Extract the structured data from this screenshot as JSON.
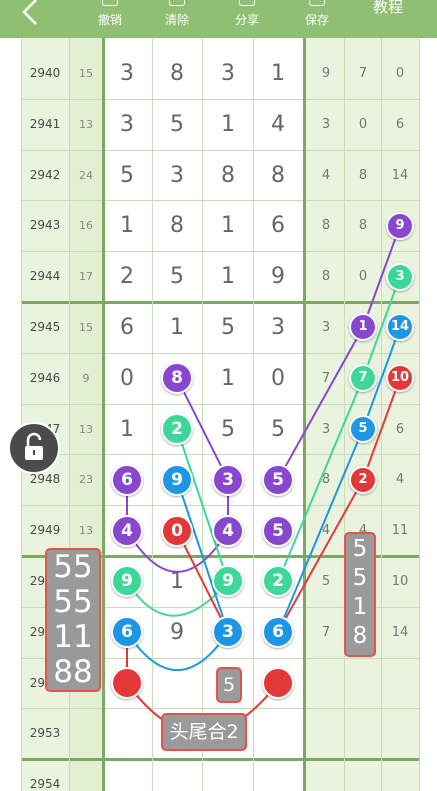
{
  "toolbar": {
    "back_icon": "chevron-left-icon",
    "undo_label": "撤销",
    "clear_label": "清除",
    "share_label": "分享",
    "save_label": "保存",
    "tutorial_label": "教程"
  },
  "colors": {
    "toolbar_bg": "#8fbf72",
    "column_bg": "#e9f3de",
    "purple": "#8847cf",
    "green": "#3ed79a",
    "blue": "#1e96e3",
    "red": "#e33838"
  },
  "rows": [
    {
      "issue": "2940",
      "sum": "15",
      "digits": [
        "3",
        "8",
        "3",
        "1"
      ],
      "right": [
        "9",
        "7",
        "0"
      ]
    },
    {
      "issue": "2941",
      "sum": "13",
      "digits": [
        "3",
        "5",
        "1",
        "4"
      ],
      "right": [
        "3",
        "0",
        "6"
      ]
    },
    {
      "issue": "2942",
      "sum": "24",
      "digits": [
        "5",
        "3",
        "8",
        "8"
      ],
      "right": [
        "4",
        "8",
        "14"
      ]
    },
    {
      "issue": "2943",
      "sum": "16",
      "digits": [
        "1",
        "8",
        "1",
        "6"
      ],
      "right": [
        "8",
        "8",
        ""
      ]
    },
    {
      "issue": "2944",
      "sum": "17",
      "digits": [
        "2",
        "5",
        "1",
        "9"
      ],
      "right": [
        "8",
        "0",
        ""
      ]
    },
    {
      "issue": "2945",
      "sum": "15",
      "digits": [
        "6",
        "1",
        "5",
        "3"
      ],
      "right": [
        "3",
        "",
        ""
      ]
    },
    {
      "issue": "2946",
      "sum": "9",
      "digits": [
        "0",
        "",
        "1",
        "0"
      ],
      "right": [
        "7",
        "",
        ""
      ]
    },
    {
      "issue": "2947",
      "sum": "13",
      "digits": [
        "1",
        "",
        "5",
        "5"
      ],
      "right": [
        "3",
        "",
        "6"
      ]
    },
    {
      "issue": "2948",
      "sum": "23",
      "digits": [
        "",
        "",
        "",
        ""
      ],
      "right": [
        "8",
        "",
        "4"
      ]
    },
    {
      "issue": "2949",
      "sum": "13",
      "digits": [
        "",
        "",
        "",
        ""
      ],
      "right": [
        "4",
        "4",
        "11"
      ]
    },
    {
      "issue": "2950",
      "sum": "",
      "digits": [
        "",
        "1",
        "",
        ""
      ],
      "right": [
        "5",
        "",
        "10"
      ]
    },
    {
      "issue": "2951",
      "sum": "",
      "digits": [
        "",
        "9",
        "",
        ""
      ],
      "right": [
        "7",
        "",
        "14"
      ]
    },
    {
      "issue": "2952",
      "sum": "",
      "digits": [
        "",
        "",
        "",
        ""
      ],
      "right": [
        "",
        "",
        ""
      ]
    },
    {
      "issue": "2953",
      "sum": "",
      "digits": [
        "",
        "",
        "",
        ""
      ],
      "right": [
        "",
        "",
        ""
      ]
    },
    {
      "issue": "2954",
      "sum": "",
      "digits": [
        "",
        "",
        "",
        ""
      ],
      "right": [
        "",
        "",
        ""
      ]
    }
  ],
  "balls": [
    {
      "label": "8",
      "color": "purple",
      "row": 6,
      "col": 1
    },
    {
      "label": "2",
      "color": "green",
      "row": 7,
      "col": 1
    },
    {
      "label": "6",
      "color": "purple",
      "row": 8,
      "col": 0
    },
    {
      "label": "9",
      "color": "blue",
      "row": 8,
      "col": 1
    },
    {
      "label": "3",
      "color": "purple",
      "row": 8,
      "col": 2
    },
    {
      "label": "5",
      "color": "purple",
      "row": 8,
      "col": 3
    },
    {
      "label": "4",
      "color": "purple",
      "row": 9,
      "col": 0
    },
    {
      "label": "0",
      "color": "red",
      "row": 9,
      "col": 1
    },
    {
      "label": "4",
      "color": "purple",
      "row": 9,
      "col": 2
    },
    {
      "label": "5",
      "color": "purple",
      "row": 9,
      "col": 3
    },
    {
      "label": "9",
      "color": "green",
      "row": 10,
      "col": 0
    },
    {
      "label": "9",
      "color": "green",
      "row": 10,
      "col": 2
    },
    {
      "label": "2",
      "color": "green",
      "row": 10,
      "col": 3
    },
    {
      "label": "6",
      "color": "blue",
      "row": 11,
      "col": 0
    },
    {
      "label": "3",
      "color": "blue",
      "row": 11,
      "col": 2
    },
    {
      "label": "6",
      "color": "blue",
      "row": 11,
      "col": 3
    },
    {
      "label": "",
      "color": "red",
      "row": 12,
      "col": 0
    },
    {
      "label": "",
      "color": "red",
      "row": 12,
      "col": 3
    }
  ],
  "side_balls": [
    {
      "label": "9",
      "color": "purple",
      "row": 3,
      "col": 2
    },
    {
      "label": "3",
      "color": "green",
      "row": 4,
      "col": 2
    },
    {
      "label": "1",
      "color": "purple",
      "row": 5,
      "col": 1
    },
    {
      "label": "14",
      "color": "blue",
      "row": 5,
      "col": 2
    },
    {
      "label": "7",
      "color": "green",
      "row": 6,
      "col": 1
    },
    {
      "label": "10",
      "color": "red",
      "row": 6,
      "col": 2
    },
    {
      "label": "5",
      "color": "blue",
      "row": 7,
      "col": 1
    },
    {
      "label": "2",
      "color": "red",
      "row": 8,
      "col": 1
    }
  ],
  "left_box": [
    "55",
    "55",
    "11",
    "88"
  ],
  "right_box": [
    "5",
    "5",
    "1",
    "8"
  ],
  "mid_box": "5",
  "bottom_label": "头尾合2",
  "lock_icon": "unlock-icon"
}
